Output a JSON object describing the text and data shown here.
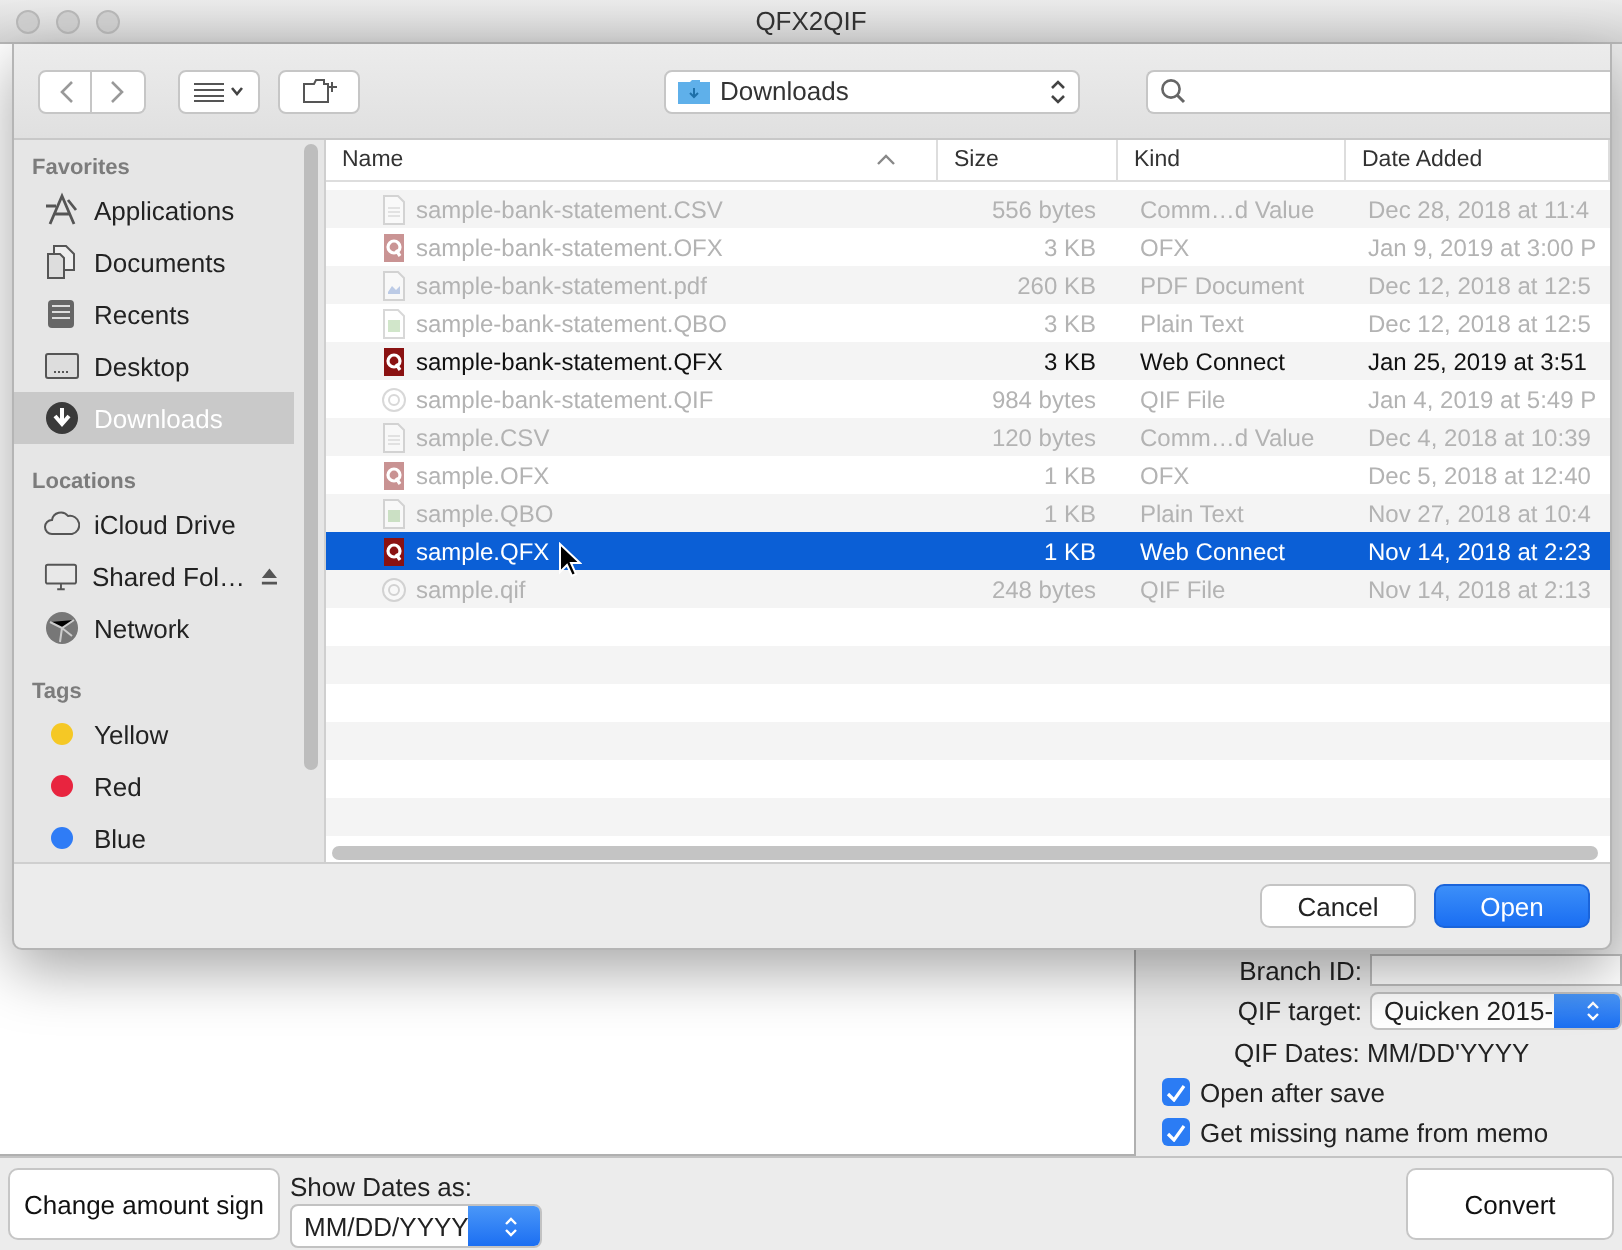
{
  "window": {
    "title": "QFX2QIF"
  },
  "dialog": {
    "location": "Downloads",
    "sidebar": [
      {
        "heading": "Favorites",
        "items": [
          {
            "label": "Applications",
            "kind": "applications",
            "selected": false
          },
          {
            "label": "Documents",
            "kind": "documents",
            "selected": false
          },
          {
            "label": "Recents",
            "kind": "recents",
            "selected": false
          },
          {
            "label": "Desktop",
            "kind": "desktop",
            "selected": false
          },
          {
            "label": "Downloads",
            "kind": "downloads",
            "selected": true
          }
        ]
      },
      {
        "heading": "Locations",
        "items": [
          {
            "label": "iCloud Drive",
            "kind": "cloud",
            "selected": false,
            "eject": false
          },
          {
            "label": "Shared Fol…",
            "kind": "display",
            "selected": false,
            "eject": true
          },
          {
            "label": "Network",
            "kind": "network",
            "selected": false,
            "eject": false
          }
        ]
      },
      {
        "heading": "Tags",
        "items": [
          {
            "label": "Yellow",
            "kind": "tag",
            "color": "#f5c825",
            "selected": false
          },
          {
            "label": "Red",
            "kind": "tag",
            "color": "#e8243f",
            "selected": false
          },
          {
            "label": "Blue",
            "kind": "tag",
            "color": "#2f7cf6",
            "selected": false
          }
        ]
      }
    ],
    "columns": [
      {
        "label": "Name",
        "sorted": true
      },
      {
        "label": "Size",
        "sorted": false
      },
      {
        "label": "Kind",
        "sorted": false
      },
      {
        "label": "Date Added",
        "sorted": false
      }
    ],
    "files": [
      {
        "name": "sample-bank-statement.CSV",
        "size": "556 bytes",
        "file_kind": "Comm…d Value",
        "date": "Dec 28, 2018 at 11:4",
        "kind": "csv",
        "enabled": false,
        "selected": false
      },
      {
        "name": "sample-bank-statement.OFX",
        "size": "3 KB",
        "file_kind": "OFX",
        "date": "Jan 9, 2019 at 3:00 P",
        "kind": "quicken",
        "enabled": false,
        "selected": false
      },
      {
        "name": "sample-bank-statement.pdf",
        "size": "260 KB",
        "file_kind": "PDF Document",
        "date": "Dec 12, 2018 at 12:5",
        "kind": "pdf",
        "enabled": false,
        "selected": false
      },
      {
        "name": "sample-bank-statement.QBO",
        "size": "3 KB",
        "file_kind": "Plain Text",
        "date": "Dec 12, 2018 at 12:5",
        "kind": "qbo",
        "enabled": false,
        "selected": false
      },
      {
        "name": "sample-bank-statement.QFX",
        "size": "3 KB",
        "file_kind": "Web Connect",
        "date": "Jan 25, 2019 at 3:51",
        "kind": "quicken",
        "enabled": true,
        "selected": false
      },
      {
        "name": "sample-bank-statement.QIF",
        "size": "984 bytes",
        "file_kind": "QIF File",
        "date": "Jan 4, 2019 at 5:49 P",
        "kind": "qif",
        "enabled": false,
        "selected": false
      },
      {
        "name": "sample.CSV",
        "size": "120 bytes",
        "file_kind": "Comm…d Value",
        "date": "Dec 4, 2018 at 10:39",
        "kind": "csv",
        "enabled": false,
        "selected": false
      },
      {
        "name": "sample.OFX",
        "size": "1 KB",
        "file_kind": "OFX",
        "date": "Dec 5, 2018 at 12:40",
        "kind": "quicken",
        "enabled": false,
        "selected": false
      },
      {
        "name": "sample.QBO",
        "size": "1 KB",
        "file_kind": "Plain Text",
        "date": "Nov 27, 2018 at 10:4",
        "kind": "qbo",
        "enabled": false,
        "selected": false
      },
      {
        "name": "sample.QFX",
        "size": "1 KB",
        "file_kind": "Web Connect",
        "date": "Nov 14, 2018 at 2:23",
        "kind": "quicken",
        "enabled": true,
        "selected": true
      },
      {
        "name": "sample.qif",
        "size": "248 bytes",
        "file_kind": "QIF File",
        "date": "Nov 14, 2018 at 2:13",
        "kind": "qif",
        "enabled": false,
        "selected": false
      }
    ],
    "buttons": [
      {
        "label": "Cancel",
        "kind": "secondary"
      },
      {
        "label": "Open",
        "kind": "default"
      }
    ]
  },
  "options": {
    "branch_label": "Branch ID:",
    "target_label": "QIF target:",
    "target_value": "Quicken 2015-",
    "qif_dates": "QIF Dates: MM/DD'YYYY",
    "checkboxes": [
      {
        "label": "Open after save",
        "checked": true
      },
      {
        "label": "Get missing name from memo",
        "checked": true
      }
    ],
    "convert": "Convert"
  },
  "bottom": {
    "change_sign": "Change amount sign",
    "dates_label": "Show Dates as:",
    "dates_value": "MM/DD/YYYY"
  }
}
